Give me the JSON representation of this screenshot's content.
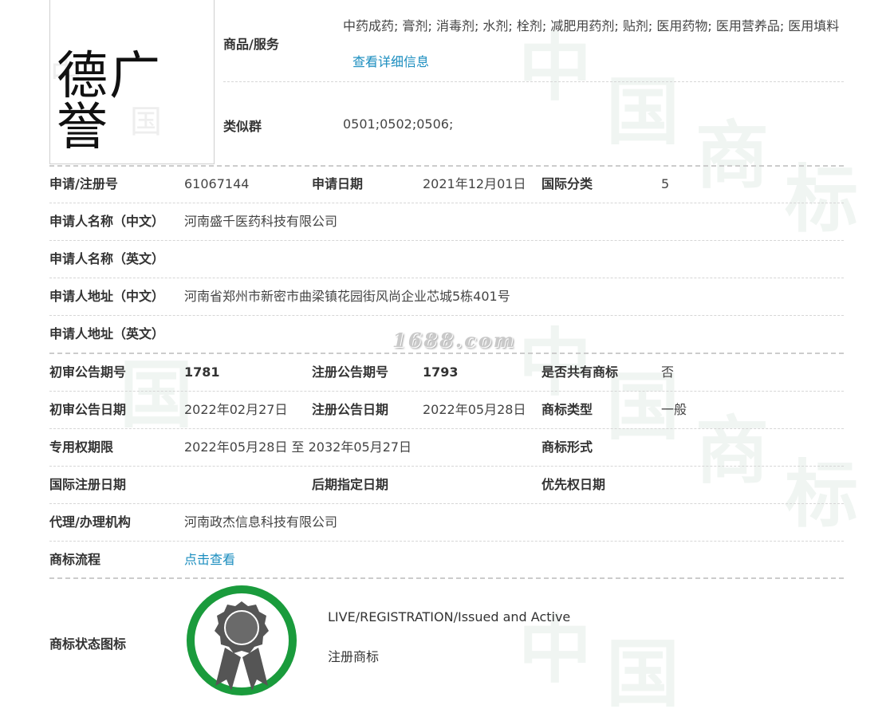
{
  "logo": {
    "mark_text": "德广誉"
  },
  "goods": {
    "label": "商品/服务",
    "value": "中药成药; 膏剂; 消毒剂; 水剂; 栓剂; 减肥用药剂; 贴剂; 医用药物; 医用营养品; 医用填料",
    "link": "查看详细信息"
  },
  "similar_group": {
    "label": "类似群",
    "value": "0501;0502;0506;"
  },
  "watermark": {
    "site": "1688.com",
    "chars": [
      "中",
      "国",
      "商",
      "标"
    ]
  },
  "rows": {
    "reg_no": {
      "label": "申请/注册号",
      "value": "61067144"
    },
    "apply_date": {
      "label": "申请日期",
      "value": "2021年12月01日"
    },
    "intl_class": {
      "label": "国际分类",
      "value": "5"
    },
    "applicant_cn": {
      "label": "申请人名称（中文）",
      "value": "河南盛千医药科技有限公司"
    },
    "applicant_en": {
      "label": "申请人名称（英文）",
      "value": ""
    },
    "address_cn": {
      "label": "申请人地址（中文）",
      "value": "河南省郑州市新密市曲梁镇花园街风尚企业芯城5栋401号"
    },
    "address_en": {
      "label": "申请人地址（英文）",
      "value": ""
    },
    "prelim_pub_no": {
      "label": "初审公告期号",
      "value": "1781"
    },
    "reg_pub_no": {
      "label": "注册公告期号",
      "value": "1793"
    },
    "shared": {
      "label": "是否共有商标",
      "value": "否"
    },
    "prelim_pub_date": {
      "label": "初审公告日期",
      "value": "2022年02月27日"
    },
    "reg_pub_date": {
      "label": "注册公告日期",
      "value": "2022年05月28日"
    },
    "tm_type": {
      "label": "商标类型",
      "value": "一般"
    },
    "exclusive_period": {
      "label": "专用权期限",
      "value": "2022年05月28日 至 2032年05月27日"
    },
    "tm_form": {
      "label": "商标形式",
      "value": ""
    },
    "intl_reg_date": {
      "label": "国际注册日期",
      "value": ""
    },
    "later_designation": {
      "label": "后期指定日期",
      "value": ""
    },
    "priority_date": {
      "label": "优先权日期",
      "value": ""
    },
    "agent": {
      "label": "代理/办理机构",
      "value": "河南政杰信息科技有限公司"
    },
    "process": {
      "label": "商标流程",
      "value": "点击查看"
    }
  },
  "status": {
    "label": "商标状态图标",
    "en": "LIVE/REGISTRATION/Issued and Active",
    "cn": "注册商标",
    "ring_color": "#1a9b3c",
    "seal_color": "#555555"
  }
}
